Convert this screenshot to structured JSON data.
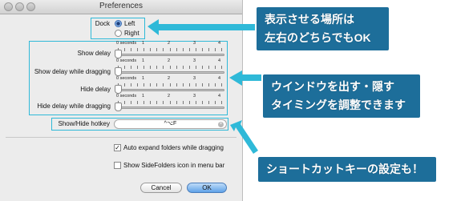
{
  "window": {
    "title": "Preferences"
  },
  "dock": {
    "label": "Dock",
    "options": [
      "Left",
      "Right"
    ],
    "selected": "Left"
  },
  "tick_labels": [
    "0 seconds",
    "1",
    "2",
    "3",
    "4"
  ],
  "sliders": [
    {
      "label": "Show delay",
      "value_seconds": 0
    },
    {
      "label": "Show delay while dragging",
      "value_seconds": 0
    },
    {
      "label": "Hide delay",
      "value_seconds": 0
    },
    {
      "label": "Hide delay while dragging",
      "value_seconds": 0
    }
  ],
  "hotkey": {
    "label": "Show/Hide hotkey",
    "value": "^⌥F"
  },
  "checkboxes": [
    {
      "label": "Auto expand folders while dragging",
      "checked": true
    },
    {
      "label": "Show SideFolders icon in menu bar",
      "checked": false
    }
  ],
  "buttons": {
    "cancel": "Cancel",
    "ok": "OK"
  },
  "callouts": [
    {
      "lines": [
        "表示させる場所は",
        "左右のどちらでもOK"
      ]
    },
    {
      "lines": [
        "ウインドウを出す・隠す",
        "タイミングを調整できます"
      ]
    },
    {
      "lines": [
        "ショートカットキーの設定も！"
      ]
    }
  ],
  "colors": {
    "highlight": "#2fb9d8",
    "callout_bg": "#1d6e9a",
    "ok_button": "#5fa2e8"
  }
}
